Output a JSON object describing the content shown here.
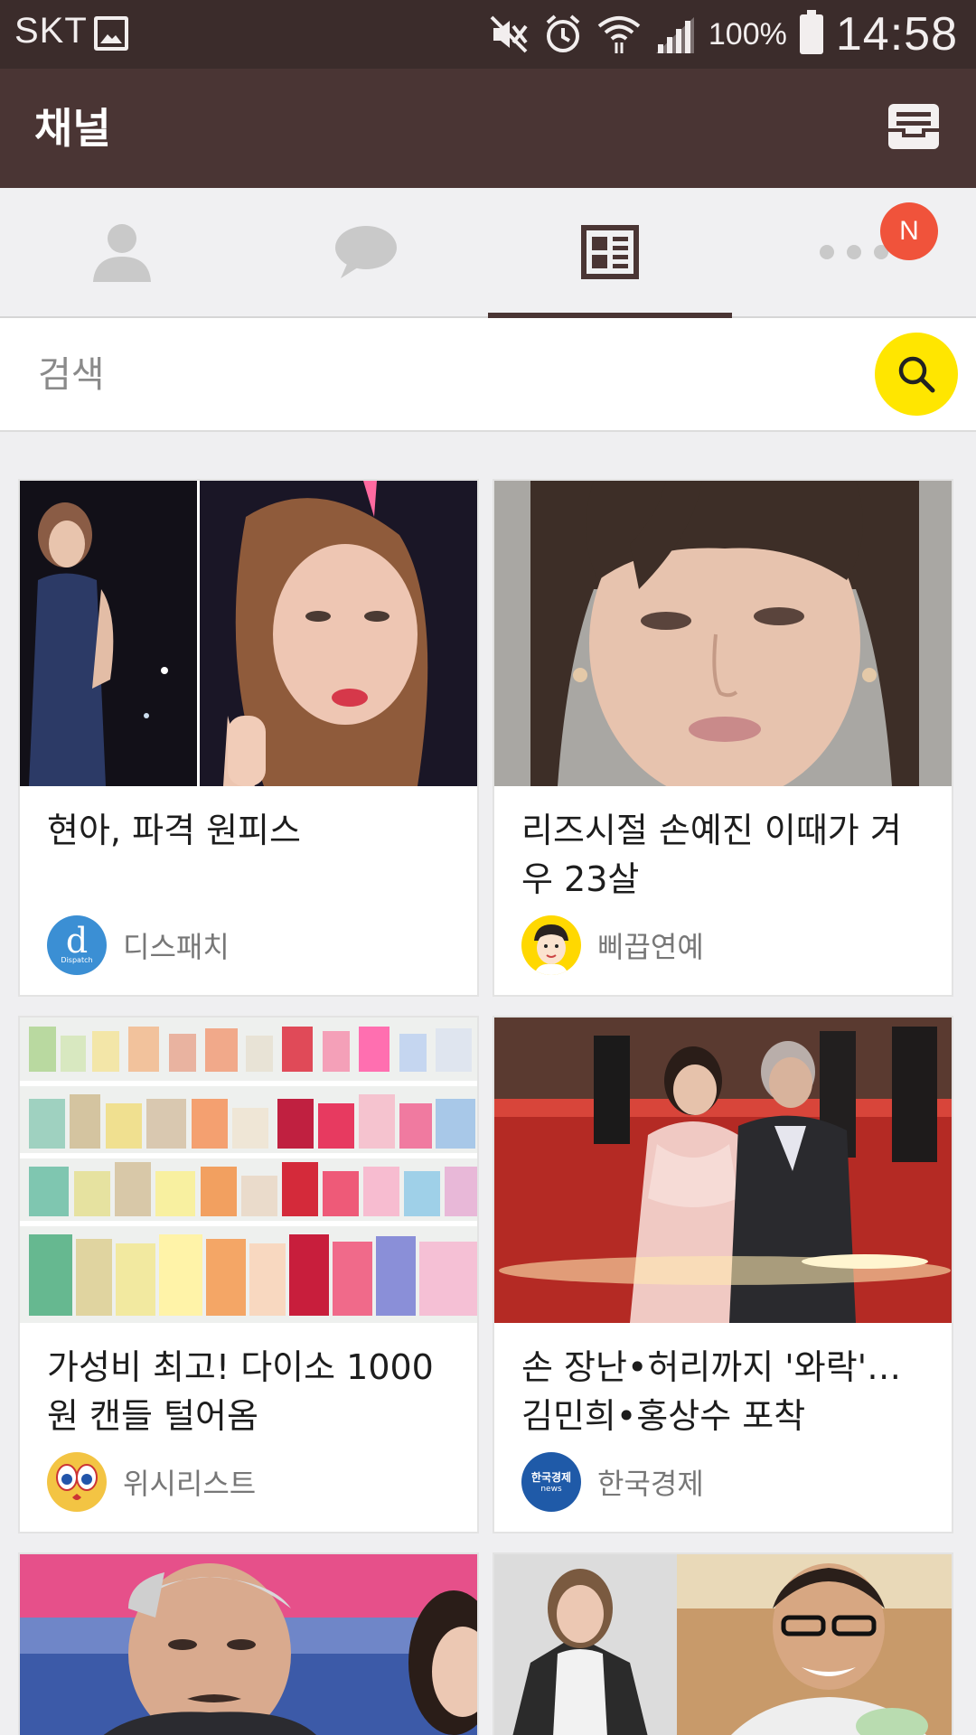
{
  "status_bar": {
    "carrier": "SKT",
    "battery": "100%",
    "time": "14:58",
    "icons": [
      "image-icon",
      "mute-icon",
      "alarm-icon",
      "wifi-icon",
      "signal-icon",
      "battery-icon"
    ]
  },
  "app_bar": {
    "title": "채널",
    "action_icon": "inbox-icon"
  },
  "tabs": [
    {
      "icon": "friends-icon",
      "active": false
    },
    {
      "icon": "chat-icon",
      "active": false
    },
    {
      "icon": "channel-icon",
      "active": true
    },
    {
      "icon": "more-icon",
      "active": false,
      "badge": "N"
    }
  ],
  "search": {
    "placeholder": "검색",
    "button_icon": "search-icon"
  },
  "cards": [
    {
      "title": "현아, 파격 원피스",
      "source": "디스패치",
      "logo_text": "d",
      "logo_sub": "Dispatch"
    },
    {
      "title": "리즈시절 손예진 이때가 겨우 23살",
      "source": "삐끕연예"
    },
    {
      "title": "가성비 최고! 다이소 1000원 캔들 털어옴",
      "source": "위시리스트"
    },
    {
      "title": "손 장난•허리까지 '와락'… 김민희•홍상수 포착",
      "source": "한국경제",
      "logo_text": "한국경제",
      "logo_sub": "news"
    }
  ],
  "colors": {
    "status_bar": "#3b2c2b",
    "app_bar": "#4a3534",
    "badge": "#f0533b",
    "search_button": "#ffe600"
  }
}
